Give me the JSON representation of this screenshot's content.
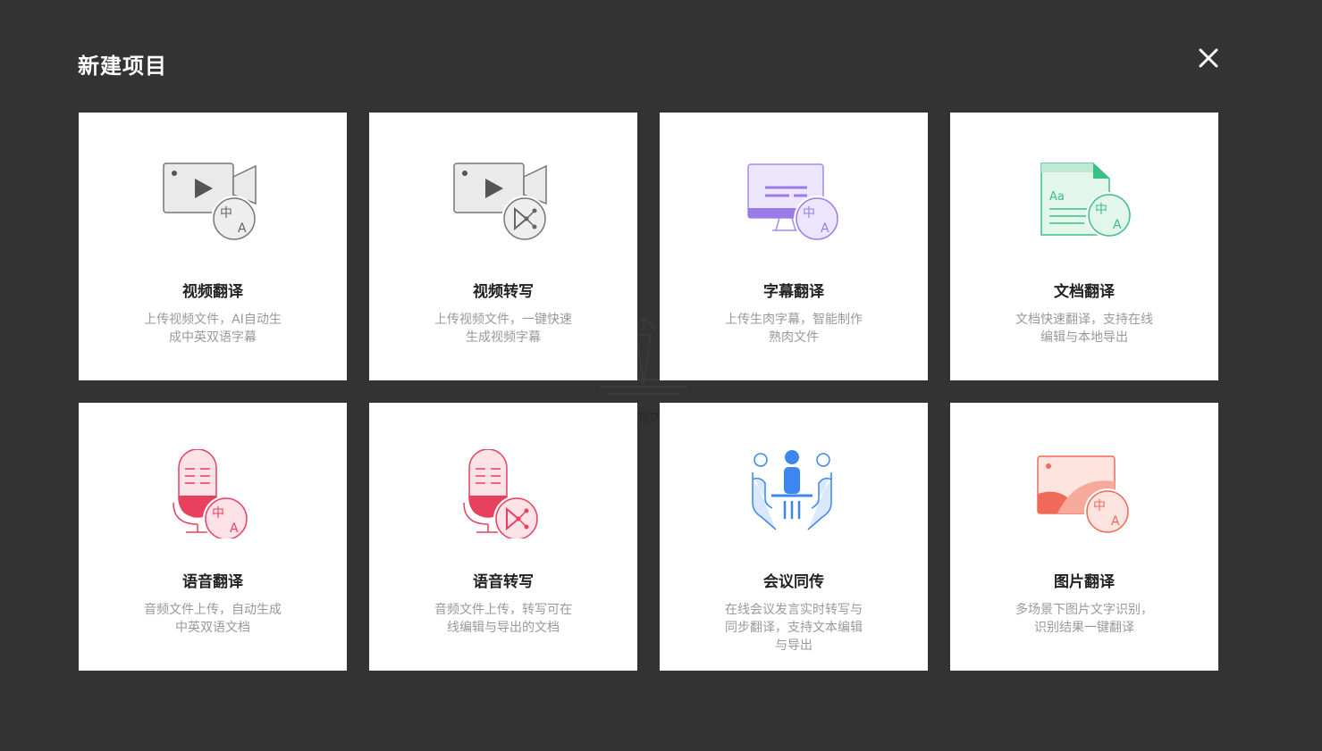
{
  "header": {
    "title": "新建项目",
    "close_icon": "close-icon"
  },
  "background": {
    "watermark_text": "有内"
  },
  "cards": [
    {
      "title": "视频翻译",
      "desc": "上传视频文件，AI自动生成中英双语字幕",
      "icon": "video-translate-icon",
      "accent": "#888888"
    },
    {
      "title": "视频转写",
      "desc": "上传视频文件，一键快速生成视频字幕",
      "icon": "video-transcribe-icon",
      "accent": "#888888"
    },
    {
      "title": "字幕翻译",
      "desc": "上传生肉字幕，智能制作熟肉文件",
      "icon": "subtitle-translate-icon",
      "accent": "#9b7be8"
    },
    {
      "title": "文档翻译",
      "desc": "文档快速翻译，支持在线编辑与本地导出",
      "icon": "document-translate-icon",
      "accent": "#3cbf86"
    },
    {
      "title": "语音翻译",
      "desc": "音频文件上传，自动生成中英双语文档",
      "icon": "audio-translate-icon",
      "accent": "#e8405f"
    },
    {
      "title": "语音转写",
      "desc": "音频文件上传，转写可在线编辑与导出的文档",
      "icon": "audio-transcribe-icon",
      "accent": "#e8405f"
    },
    {
      "title": "会议同传",
      "desc": "在线会议发言实时转写与同步翻译，支持文本编辑与导出",
      "icon": "meeting-interpret-icon",
      "accent": "#3d86f0"
    },
    {
      "title": "图片翻译",
      "desc": "多场景下图片文字识别，识别结果一键翻译",
      "icon": "image-translate-icon",
      "accent": "#f06a5a"
    }
  ]
}
